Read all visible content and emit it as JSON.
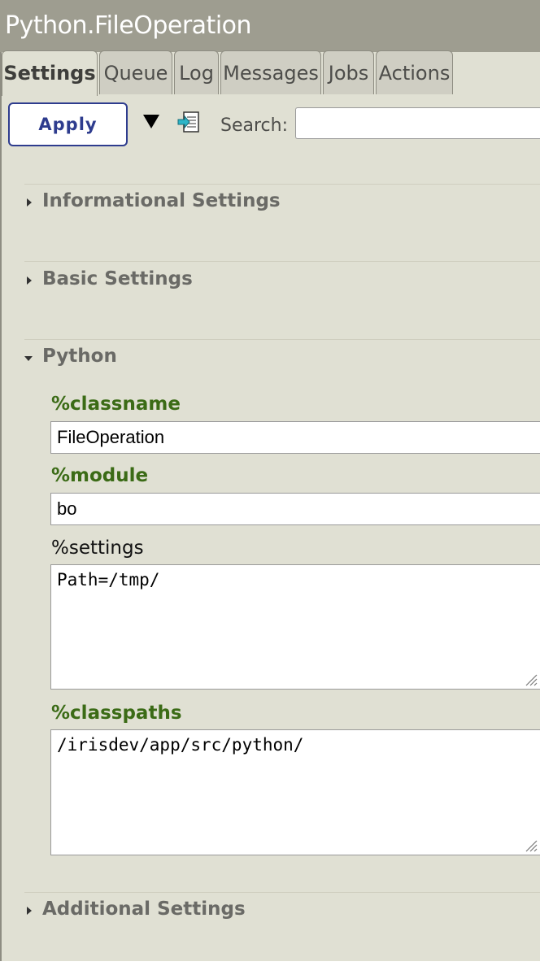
{
  "window": {
    "title": "Python.FileOperation"
  },
  "tabs": [
    {
      "label": "Settings",
      "active": true
    },
    {
      "label": "Queue"
    },
    {
      "label": "Log"
    },
    {
      "label": "Messages"
    },
    {
      "label": "Jobs"
    },
    {
      "label": "Actions"
    }
  ],
  "toolbar": {
    "apply_label": "Apply",
    "dropdown_icon": "down-triangle-icon",
    "export_icon": "document-export-icon",
    "search_label": "Search:",
    "search_value": ""
  },
  "sections": {
    "informational": {
      "label": "Informational Settings",
      "expanded": false
    },
    "basic": {
      "label": "Basic Settings",
      "expanded": false
    },
    "python": {
      "label": "Python",
      "expanded": true
    },
    "additional": {
      "label": "Additional Settings",
      "expanded": false
    }
  },
  "python_fields": {
    "classname": {
      "label": "%classname",
      "value": "FileOperation",
      "required": true
    },
    "module": {
      "label": "%module",
      "value": "bo",
      "required": true
    },
    "settings": {
      "label": "%settings",
      "value": "Path=/tmp/",
      "required": false
    },
    "classpaths": {
      "label": "%classpaths",
      "value": "/irisdev/app/src/python/",
      "required": true
    }
  },
  "colors": {
    "panel_background": "#e0e0d3",
    "titlebar_background": "#9e9d90",
    "required_label": "#3b6b16",
    "apply_button_border": "#2e3c8e"
  }
}
